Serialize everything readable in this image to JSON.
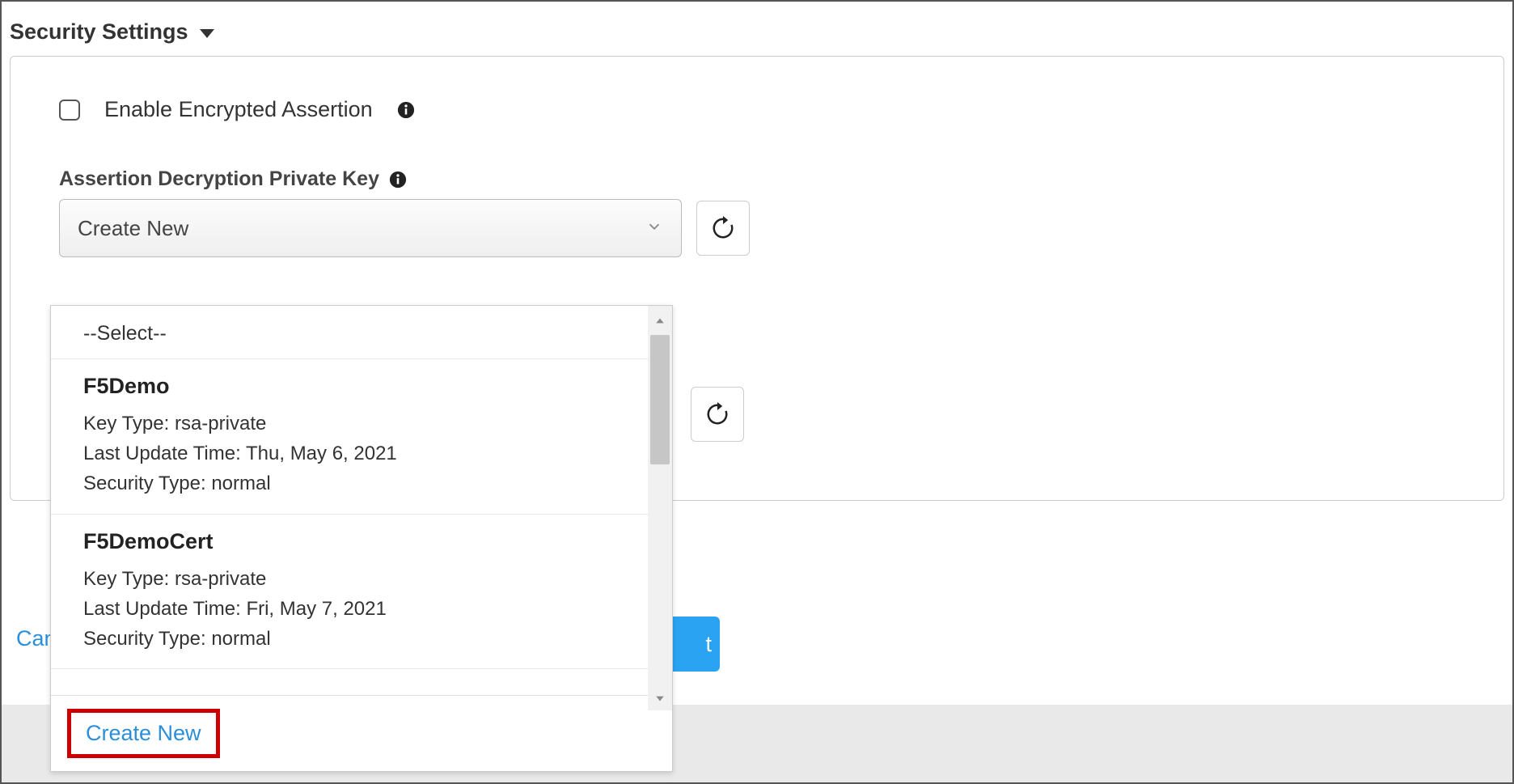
{
  "header": {
    "title": "Security Settings"
  },
  "checkbox": {
    "label": "Enable Encrypted Assertion"
  },
  "private_key": {
    "label": "Assertion Decryption Private Key",
    "selected": "Create New"
  },
  "dropdown": {
    "placeholder": "--Select--",
    "options": [
      {
        "name": "F5Demo",
        "key_type_label": "Key Type:",
        "key_type": "rsa-private",
        "last_update_label": "Last Update Time:",
        "last_update": "Thu, May 6, 2021",
        "sec_type_label": "Security Type:",
        "sec_type": "normal"
      },
      {
        "name": "F5DemoCert",
        "key_type_label": "Key Type:",
        "key_type": "rsa-private",
        "last_update_label": "Last Update Time:",
        "last_update": "Fri, May 7, 2021",
        "sec_type_label": "Security Type:",
        "sec_type": "normal"
      }
    ],
    "create_new": "Create New"
  },
  "buttons": {
    "cancel_partial": "Can",
    "next_partial": "t"
  }
}
